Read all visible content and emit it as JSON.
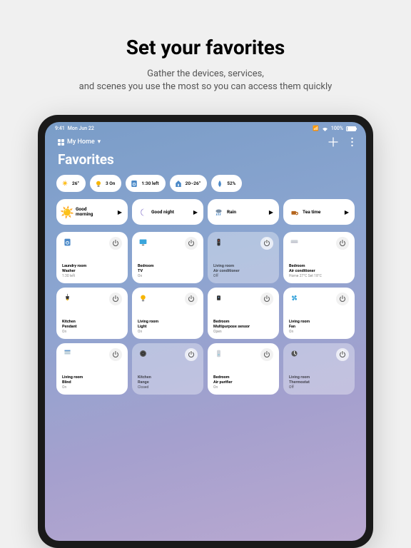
{
  "marketing": {
    "title": "Set your favorites",
    "subtitle_line1": "Gather the devices, services,",
    "subtitle_line2": "and scenes you use the most so you can access them quickly"
  },
  "status_bar": {
    "time": "9:41",
    "date": "Mon Jun 22",
    "battery_pct": "100%"
  },
  "header": {
    "home_name": "My Home",
    "chevron": "▾"
  },
  "page_title": "Favorites",
  "pills": [
    {
      "icon": "sun",
      "label": "26°"
    },
    {
      "icon": "bulb",
      "label": "3 On"
    },
    {
      "icon": "washer",
      "label": "1:30 left"
    },
    {
      "icon": "home-temp",
      "label": "20~26°"
    },
    {
      "icon": "humidity",
      "label": "52%"
    }
  ],
  "scenes": [
    {
      "icon": "sun",
      "label": "Good\nmorning"
    },
    {
      "icon": "moon",
      "label": "Good night"
    },
    {
      "icon": "rain",
      "label": "Rain"
    },
    {
      "icon": "tea",
      "label": "Tea time"
    }
  ],
  "devices": [
    {
      "icon": "washer",
      "loc": "Laundry room",
      "name": "Washer",
      "status": "1:30 left",
      "on": true
    },
    {
      "icon": "tv",
      "loc": "Bedroom",
      "name": "TV",
      "status": "On",
      "on": true
    },
    {
      "icon": "remote",
      "loc": "Living room",
      "name": "Air conditioner",
      "status": "Off",
      "on": false
    },
    {
      "icon": "ac",
      "loc": "Bedroom",
      "name": "Air conditioner",
      "status": "Home 27°C Set 18°C",
      "on": true
    },
    {
      "icon": "pendant",
      "loc": "Kitchen",
      "name": "Pendant",
      "status": "On",
      "on": true
    },
    {
      "icon": "bulb",
      "loc": "Living room",
      "name": "Light",
      "status": "On",
      "on": true
    },
    {
      "icon": "sensor",
      "loc": "Bedroom",
      "name": "Multipurpose sensor",
      "status": "Open",
      "on": true
    },
    {
      "icon": "fan",
      "loc": "Living room",
      "name": "Fan",
      "status": "On",
      "on": true
    },
    {
      "icon": "blind",
      "loc": "Living room",
      "name": "Blind",
      "status": "On",
      "on": true
    },
    {
      "icon": "range",
      "loc": "Kitchen",
      "name": "Range",
      "status": "Closed",
      "on": false
    },
    {
      "icon": "purifier",
      "loc": "Bedroom",
      "name": "Air purifier",
      "status": "On",
      "on": true
    },
    {
      "icon": "thermostat",
      "loc": "Living room",
      "name": "Thermostat",
      "status": "Off",
      "on": false
    }
  ]
}
